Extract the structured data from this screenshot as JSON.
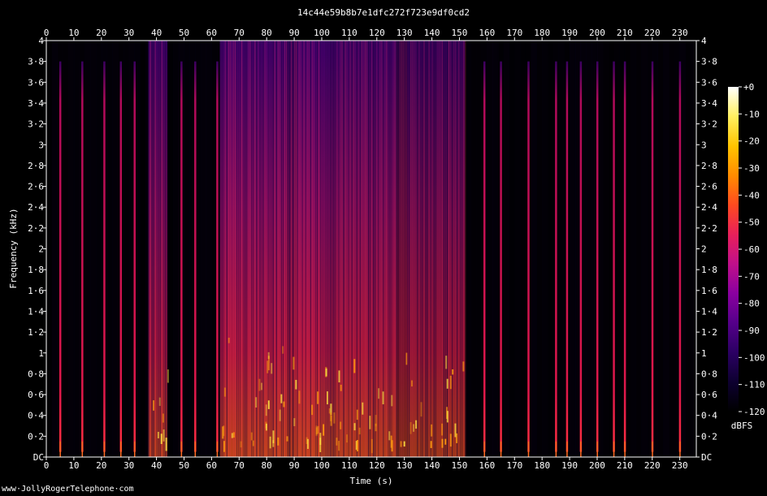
{
  "chart_data": {
    "type": "heatmap",
    "title": "14c44e59b8b7e1dfc272f723e9df0cd2",
    "xlabel": "Time (s)",
    "ylabel": "Frequency (kHz)",
    "xlim": [
      0,
      236
    ],
    "ylim": [
      0,
      4
    ],
    "x_ticks": [
      "0",
      "10",
      "20",
      "30",
      "40",
      "50",
      "60",
      "70",
      "80",
      "90",
      "100",
      "110",
      "120",
      "130",
      "140",
      "150",
      "160",
      "170",
      "180",
      "190",
      "200",
      "210",
      "220",
      "230"
    ],
    "y_ticks": [
      "DC",
      "0·2",
      "0·4",
      "0·6",
      "0·8",
      "1",
      "1·2",
      "1·4",
      "1·6",
      "1·8",
      "2",
      "2·2",
      "2·4",
      "2·6",
      "2·8",
      "3",
      "3·2",
      "3·4",
      "3·6",
      "3·8",
      "4"
    ],
    "colorbar": {
      "label": "dBFS",
      "ticks": [
        "+0",
        "-10",
        "-20",
        "-30",
        "-40",
        "-50",
        "-60",
        "-70",
        "-80",
        "-90",
        "-100",
        "-110",
        "-120"
      ],
      "range": [
        -120,
        0
      ],
      "colormap": [
        "#000000",
        "#0d0030",
        "#2b0063",
        "#55008a",
        "#8a00a0",
        "#c0108a",
        "#e8205a",
        "#ff4a20",
        "#ff8c00",
        "#ffc400",
        "#fff060",
        "#ffffff"
      ]
    },
    "tone_times_s": [
      5,
      13,
      21,
      27,
      32,
      49,
      54,
      62,
      159,
      165,
      175,
      185,
      189,
      194,
      200,
      206,
      210,
      220,
      230
    ],
    "speech_segments": [
      {
        "start": 37,
        "end": 44,
        "level_db": -55
      },
      {
        "start": 63,
        "end": 87,
        "level_db": -50
      },
      {
        "start": 87,
        "end": 91,
        "level_db": -65
      },
      {
        "start": 91,
        "end": 103,
        "level_db": -48
      },
      {
        "start": 103,
        "end": 127,
        "level_db": -58
      },
      {
        "start": 127,
        "end": 131,
        "level_db": -90
      },
      {
        "start": 131,
        "end": 152,
        "level_db": -70
      }
    ],
    "background_db": -118,
    "grid": false
  },
  "footer": {
    "credit": "www·JollyRogerTelephone·com"
  }
}
